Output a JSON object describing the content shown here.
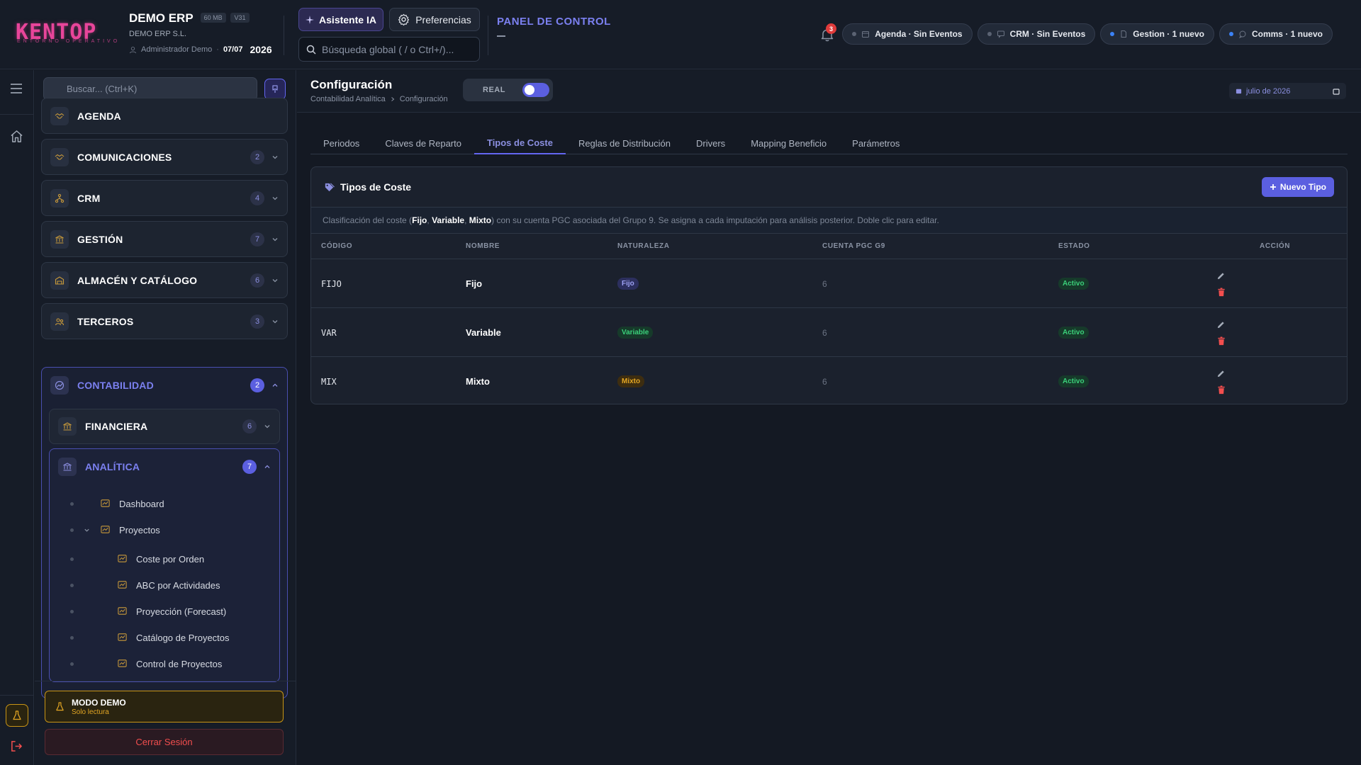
{
  "header": {
    "logo_text": "KENTOP",
    "logo_subtitle": "ENTORNO OPERATIVO",
    "app_title": "DEMO ERP",
    "size_chip": "60 MB",
    "version_chip": "V31",
    "company": "DEMO ERP S.L.",
    "user": "Administrador Demo",
    "date": "07/07",
    "year": "2026",
    "ai_button": "Asistente IA",
    "prefs_button": "Preferencias",
    "search_placeholder": "Búsqueda global ( / o Ctrl+/)...",
    "panel_title": "PANEL DE CONTROL",
    "notifications_count": "3",
    "status_pills": [
      {
        "label": "Agenda · Sin Eventos",
        "dot": "#5b6373",
        "icon": "calendar-icon"
      },
      {
        "label": "CRM · Sin Eventos",
        "dot": "#5b6373",
        "icon": "chat-icon"
      },
      {
        "label": "Gestion · 1 nuevo",
        "dot": "#3b82f6",
        "icon": "doc-icon"
      },
      {
        "label": "Comms · 1 nuevo",
        "dot": "#3b82f6",
        "icon": "bubble-icon"
      }
    ]
  },
  "sidebar": {
    "search_placeholder": "Buscar... (Ctrl+K)",
    "items": [
      {
        "label": "AGENDA",
        "count": ""
      },
      {
        "label": "COMUNICACIONES",
        "count": "2"
      },
      {
        "label": "CRM",
        "count": "4"
      },
      {
        "label": "GESTIÓN",
        "count": "7"
      },
      {
        "label": "ALMACÉN Y CATÁLOGO",
        "count": "6"
      },
      {
        "label": "TERCEROS",
        "count": "3"
      }
    ],
    "contabilidad": {
      "label": "CONTABILIDAD",
      "count": "2",
      "financiera": {
        "label": "FINANCIERA",
        "count": "6"
      },
      "analitica": {
        "label": "ANALÍTICA",
        "count": "7",
        "children": [
          {
            "label": "Dashboard"
          },
          {
            "label": "Proyectos"
          },
          {
            "label": "Coste por Orden"
          },
          {
            "label": "ABC por Actividades"
          },
          {
            "label": "Proyección (Forecast)"
          },
          {
            "label": "Catálogo de Proyectos"
          },
          {
            "label": "Control de Proyectos"
          }
        ]
      }
    },
    "demo": {
      "title": "MODO DEMO",
      "subtitle": "Solo lectura"
    },
    "logout": "Cerrar Sesión"
  },
  "page": {
    "title": "Configuración",
    "breadcrumb": [
      "Contabilidad Analítica",
      "Configuración"
    ],
    "mode_label": "REAL",
    "mode_on": true,
    "date_picker": "julio de 2026",
    "tabs": [
      "Periodos",
      "Claves de Reparto",
      "Tipos de Coste",
      "Reglas de Distribución",
      "Drivers",
      "Mapping Beneficio",
      "Parámetros"
    ],
    "active_tab": "Tipos de Coste"
  },
  "card": {
    "title": "Tipos de Coste",
    "new_button": "Nuevo Tipo",
    "description": {
      "p1": "Clasificación del coste (",
      "b1": "Fijo",
      "s1": ", ",
      "b2": "Variable",
      "s2": ", ",
      "b3": "Mixto",
      "p2": ") con su cuenta PGC asociada del Grupo 9. Se asigna a cada imputación para análisis posterior. Doble clic para editar."
    },
    "columns": [
      "CÓDIGO",
      "NOMBRE",
      "NATURALEZA",
      "CUENTA PGC G9",
      "ESTADO",
      "ACCIÓN"
    ],
    "rows": [
      {
        "code": "FIJO",
        "name": "Fijo",
        "nature": "Fijo",
        "pgc": "6",
        "status": "Activo"
      },
      {
        "code": "VAR",
        "name": "Variable",
        "nature": "Variable",
        "pgc": "6",
        "status": "Activo"
      },
      {
        "code": "MIX",
        "name": "Mixto",
        "nature": "Mixto",
        "pgc": "6",
        "status": "Activo"
      }
    ]
  },
  "colors": {
    "accent": "#6366f1",
    "nature_fijo_bg": "#2c2f5e",
    "nature_fijo_fg": "#9ea2f5",
    "nature_variable_bg": "#163a2a",
    "nature_variable_fg": "#3bd07a",
    "nature_mixto_bg": "#3d2d10",
    "nature_mixto_fg": "#e3a623",
    "status_bg": "#163a2a",
    "status_fg": "#3bd07a",
    "edit": "#a4acb9",
    "delete": "#f24e4e"
  }
}
